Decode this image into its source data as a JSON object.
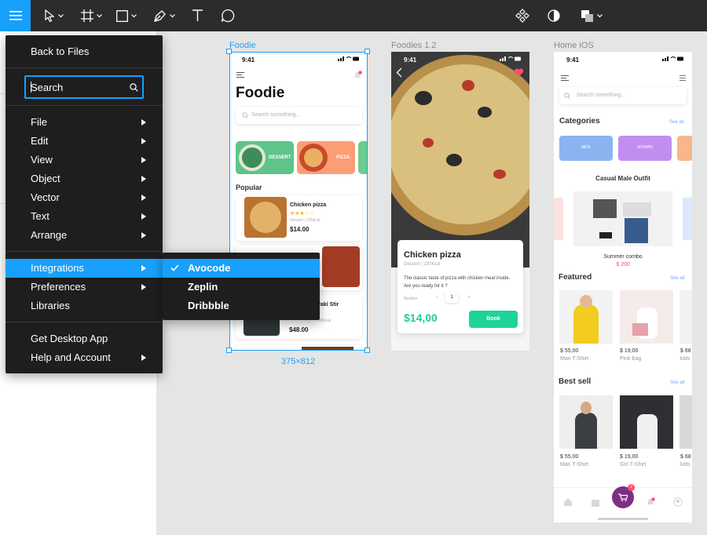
{
  "toolbar": {
    "colors": {
      "bar": "#2c2c2c",
      "accent": "#18a0fb"
    },
    "tools": [
      "menu-icon",
      "move-tool-icon",
      "frame-tool-icon",
      "shape-tool-icon",
      "pen-tool-icon",
      "text-tool-icon",
      "comment-tool-icon"
    ],
    "right_tools": [
      "component-icon",
      "mask-icon",
      "boolean-icon"
    ]
  },
  "main_menu": {
    "back": "Back to Files",
    "search_placeholder": "Search",
    "items": [
      {
        "label": "File",
        "has_submenu": true
      },
      {
        "label": "Edit",
        "has_submenu": true
      },
      {
        "label": "View",
        "has_submenu": true
      },
      {
        "label": "Object",
        "has_submenu": true
      },
      {
        "label": "Vector",
        "has_submenu": true
      },
      {
        "label": "Text",
        "has_submenu": true
      },
      {
        "label": "Arrange",
        "has_submenu": true
      }
    ],
    "integrations": "Integrations",
    "preferences": "Preferences",
    "libraries": "Libraries",
    "desktop_app": "Get Desktop App",
    "help": "Help and Account"
  },
  "submenu": {
    "items": [
      {
        "label": "Avocode",
        "checked": true
      },
      {
        "label": "Zeplin",
        "checked": false
      },
      {
        "label": "Dribbble",
        "checked": false
      }
    ]
  },
  "canvas": {
    "frames": [
      {
        "name": "Foodie",
        "selected": true,
        "size_label": "375×812"
      },
      {
        "name": "Foodies 1.2",
        "selected": false
      },
      {
        "name": "Home iOS",
        "selected": false
      }
    ]
  },
  "foodie": {
    "time": "9:41",
    "title": "Foodie",
    "search_placeholder": "Search something...",
    "cat1": "DESSERT",
    "cat2": "PIZZA",
    "popular": "Popular",
    "item1_name": "Chicken pizza",
    "item1_stars": "★★★☆☆",
    "item1_meta": "Dessert  |  230kcal",
    "item1_price": "$14.00",
    "item2_name": "yaki Stir",
    "item2_meta": "230kcal",
    "item2_price": "$48.00"
  },
  "foodies12": {
    "time": "9:41",
    "title": "Chicken pizza",
    "meta": "Dessert  |  230kcal",
    "desc": "The classic taste of pizza with chicken meat inside. Are you ready for it ?",
    "number_label": "Number",
    "qty": "1",
    "minus": "−",
    "plus": "+",
    "price": "$14,00",
    "book": "Book"
  },
  "home_ios": {
    "time": "9:41",
    "search_placeholder": "Search something...",
    "categories": "Categories",
    "see_all": "See all",
    "cat_men": "MEN",
    "cat_woman": "WOMAN",
    "banner_title": "Casual Male Outfit",
    "banner_sub": "Summer combo",
    "banner_price": "$ 200",
    "featured": "Featured",
    "f1_price": "$ 55,00",
    "f1_name": "Man T-Shirt",
    "f2_price": "$ 19,00",
    "f2_name": "Pink bag",
    "f3_price": "$ 68",
    "f3_name": "kids",
    "best_sell": "Best sell",
    "b1_price": "$ 55,00",
    "b1_name": "Man T-Shirt",
    "b2_price": "$ 19,00",
    "b2_name": "Girl T-Shirt",
    "b3_price": "$ 68",
    "b3_name": "kids",
    "cart_badge": "2"
  }
}
